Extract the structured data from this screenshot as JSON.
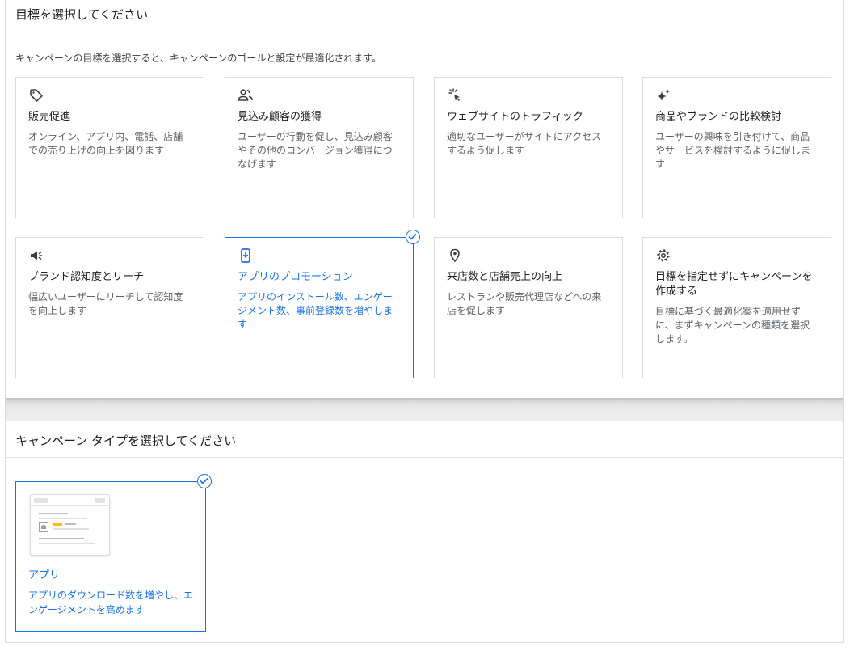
{
  "section_goal": {
    "title": "目標を選択してください",
    "description": "キャンペーンの目標を選択すると、キャンペーンのゴールと設定が最適化されます。",
    "cards": [
      {
        "icon": "tag-icon",
        "title": "販売促進",
        "desc": "オンライン、アプリ内、電話、店舗での売り上げの向上を図ります",
        "selected": false
      },
      {
        "icon": "people-icon",
        "title": "見込み顧客の獲得",
        "desc": "ユーザーの行動を促し、見込み顧客やその他のコンバージョン獲得につなげます",
        "selected": false
      },
      {
        "icon": "click-sparkle-icon",
        "title": "ウェブサイトのトラフィック",
        "desc": "適切なユーザーがサイトにアクセスするよう促します",
        "selected": false
      },
      {
        "icon": "sparkle-icon",
        "title": "商品やブランドの比較検討",
        "desc": "ユーザーの興味を引き付けて、商品やサービスを検討するように促します",
        "selected": false
      },
      {
        "icon": "megaphone-icon",
        "title": "ブランド認知度とリーチ",
        "desc": "幅広いユーザーにリーチして認知度を向上します",
        "selected": false
      },
      {
        "icon": "phone-download-icon",
        "title": "アプリのプロモーション",
        "desc": "アプリのインストール数、エンゲージメント数、事前登録数を増やします",
        "selected": true
      },
      {
        "icon": "location-pin-icon",
        "title": "来店数と店舗売上の向上",
        "desc": "レストランや販売代理店などへの来店を促します",
        "selected": false
      },
      {
        "icon": "gear-icon",
        "title": "目標を指定せずにキャンペーンを作成する",
        "desc": "目標に基づく最適化案を適用せずに、まずキャンペーンの種類を選択します。",
        "selected": false
      }
    ]
  },
  "section_type": {
    "title": "キャンペーン タイプを選択してください",
    "card": {
      "title": "アプリ",
      "desc": "アプリのダウンロード数を増やし、エンゲージメントを高めます",
      "selected": true
    }
  },
  "colors": {
    "accent": "#1a73e8",
    "border": "#dadce0",
    "text": "#202124",
    "muted": "#5f6368"
  }
}
